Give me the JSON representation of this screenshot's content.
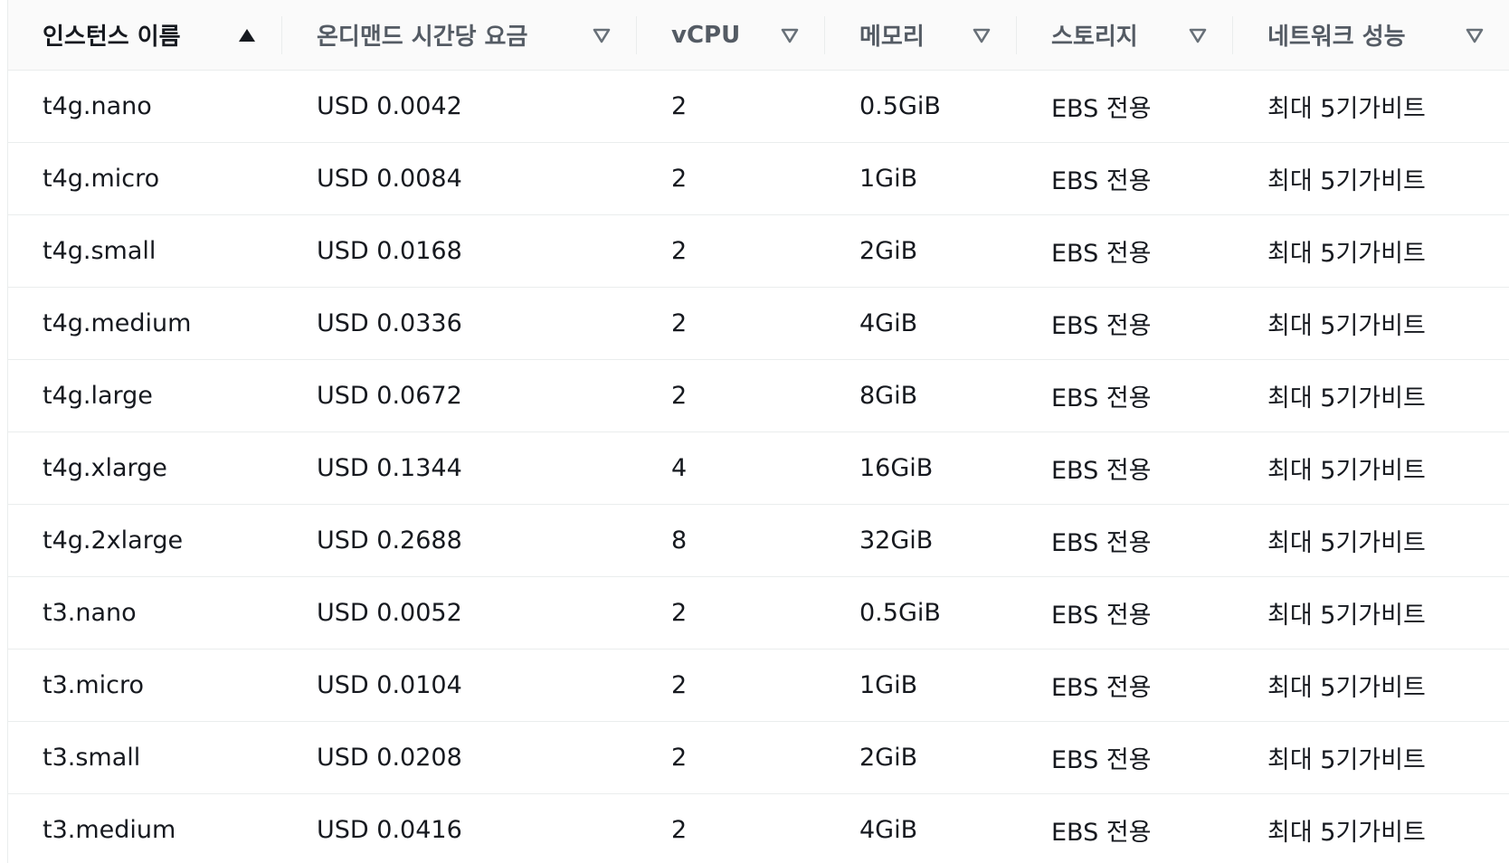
{
  "columns": [
    {
      "label": "인스턴스 이름",
      "sort": "asc"
    },
    {
      "label": "온디맨드 시간당 요금",
      "sort": "none"
    },
    {
      "label": "vCPU",
      "sort": "none"
    },
    {
      "label": "메모리",
      "sort": "none"
    },
    {
      "label": "스토리지",
      "sort": "none"
    },
    {
      "label": "네트워크 성능",
      "sort": "none"
    }
  ],
  "rows": [
    [
      "t4g.nano",
      "USD 0.0042",
      "2",
      "0.5GiB",
      "EBS 전용",
      "최대 5기가비트"
    ],
    [
      "t4g.micro",
      "USD 0.0084",
      "2",
      "1GiB",
      "EBS 전용",
      "최대 5기가비트"
    ],
    [
      "t4g.small",
      "USD 0.0168",
      "2",
      "2GiB",
      "EBS 전용",
      "최대 5기가비트"
    ],
    [
      "t4g.medium",
      "USD 0.0336",
      "2",
      "4GiB",
      "EBS 전용",
      "최대 5기가비트"
    ],
    [
      "t4g.large",
      "USD 0.0672",
      "2",
      "8GiB",
      "EBS 전용",
      "최대 5기가비트"
    ],
    [
      "t4g.xlarge",
      "USD 0.1344",
      "4",
      "16GiB",
      "EBS 전용",
      "최대 5기가비트"
    ],
    [
      "t4g.2xlarge",
      "USD 0.2688",
      "8",
      "32GiB",
      "EBS 전용",
      "최대 5기가비트"
    ],
    [
      "t3.nano",
      "USD 0.0052",
      "2",
      "0.5GiB",
      "EBS 전용",
      "최대 5기가비트"
    ],
    [
      "t3.micro",
      "USD 0.0104",
      "2",
      "1GiB",
      "EBS 전용",
      "최대 5기가비트"
    ],
    [
      "t3.small",
      "USD 0.0208",
      "2",
      "2GiB",
      "EBS 전용",
      "최대 5기가비트"
    ],
    [
      "t3.medium",
      "USD 0.0416",
      "2",
      "4GiB",
      "EBS 전용",
      "최대 5기가비트"
    ]
  ],
  "colors": {
    "text": "#16191f",
    "header_text": "#545b64",
    "header_bg": "#fafafa",
    "border": "#eaeded",
    "icon": "#687078",
    "icon_active": "#16191f"
  },
  "icons": {
    "sort_asc": "sort-ascending-icon",
    "sort_none": "sort-unsorted-icon"
  }
}
